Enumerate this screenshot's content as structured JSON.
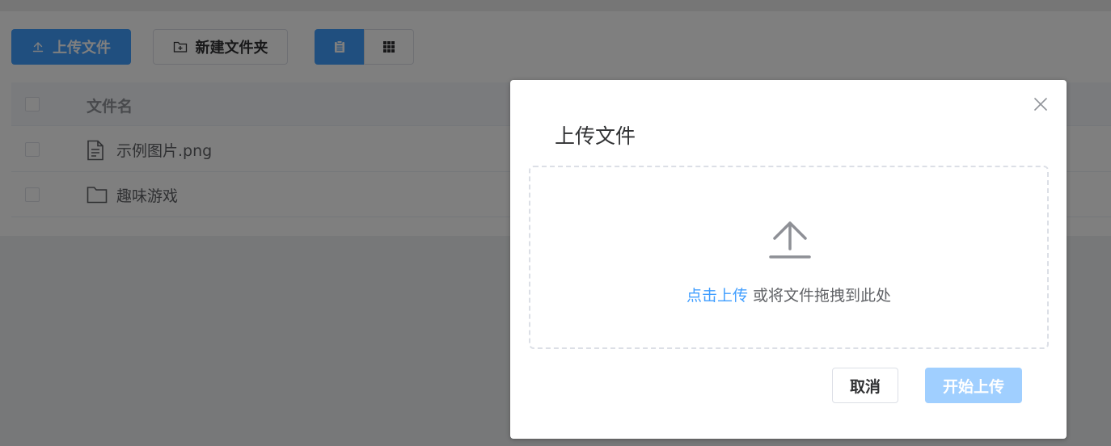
{
  "toolbar": {
    "upload_label": "上传文件",
    "new_folder_label": "新建文件夹",
    "view_modes": [
      "list-view-icon",
      "grid-view-icon"
    ]
  },
  "table": {
    "header": {
      "name": "文件名"
    },
    "rows": [
      {
        "icon": "file-icon",
        "name": "示例图片.png"
      },
      {
        "icon": "folder-icon",
        "name": "趣味游戏"
      }
    ]
  },
  "dialog": {
    "title": "上传文件",
    "drop_link": "点击上传",
    "drop_text": "或将文件拖拽到此处",
    "cancel_label": "取消",
    "start_label": "开始上传"
  },
  "colors": {
    "primary": "#409eff",
    "primary_disabled": "#a0cfff",
    "mask": "rgba(0,0,0,0.5)"
  }
}
